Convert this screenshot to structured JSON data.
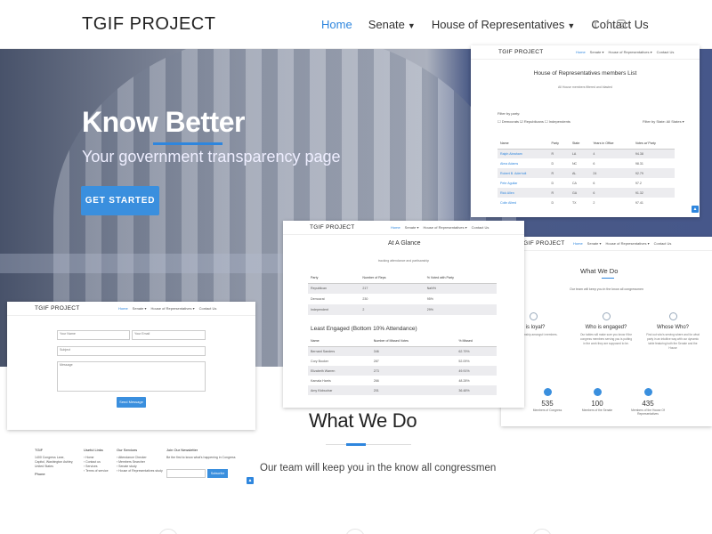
{
  "header": {
    "brand": "TGIF PROJECT",
    "nav": [
      {
        "label": "Home",
        "active": true,
        "dropdown": false
      },
      {
        "label": "Senate",
        "active": false,
        "dropdown": true
      },
      {
        "label": "House of Representatives",
        "active": false,
        "dropdown": true
      },
      {
        "label": "Contact Us",
        "active": false,
        "dropdown": false
      }
    ],
    "social_icons": [
      "twitter-icon",
      "facebook-icon",
      "instagram-icon"
    ]
  },
  "hero": {
    "title": "Know Better",
    "subtitle": "Your government transparency page",
    "cta": "GET STARTED"
  },
  "preview_house": {
    "brand": "TGIF PROJECT",
    "nav": [
      "Home",
      "Senate ▾",
      "House of Representatives ▾",
      "Contact Us"
    ],
    "title": "House of Representatives members List",
    "subtitle": "All House members filtered and blasted",
    "filter_label": "Filter by party:",
    "checkboxes": "☐ Democrats ☑ Republicans ☐ Independents",
    "state_filter": "Filter by State: All States ▾",
    "columns": [
      "Name",
      "Party",
      "State",
      "Years in Office",
      "Votes w/ Party"
    ],
    "rows": [
      [
        "Ralph Abraham",
        "R",
        "LA",
        "4",
        "94.38"
      ],
      [
        "Alma Adams",
        "D",
        "NC",
        "6",
        "98.31"
      ],
      [
        "Robert B. Aderholt",
        "R",
        "AL",
        "24",
        "92.79"
      ],
      [
        "Pete Aguilar",
        "D",
        "CA",
        "6",
        "97.2"
      ],
      [
        "Rick Allen",
        "R",
        "GA",
        "6",
        "91.32"
      ],
      [
        "Colin Allred",
        "D",
        "TX",
        "2",
        "97.41"
      ]
    ]
  },
  "preview_glance": {
    "brand": "TGIF PROJECT",
    "nav": [
      "Home",
      "Senate ▾",
      "House of Representatives ▾",
      "Contact Us"
    ],
    "title": "At A Glance",
    "subtitle": "tracking attendance and partisanship",
    "glance_columns": [
      "Party",
      "Number of Reps",
      "% Voted with Party"
    ],
    "glance_rows": [
      [
        "Republican",
        "217",
        "NaN%"
      ],
      [
        "Democrat",
        "230",
        "95%"
      ],
      [
        "Independent",
        "2",
        "29%"
      ]
    ],
    "section_title": "Least Engaged (Bottom 10% Attendance)",
    "least_columns": [
      "Name",
      "Number of Missed Votes",
      "% Missed"
    ],
    "least_rows": [
      [
        "Bernard Sanders",
        "346",
        "62.79%"
      ],
      [
        "Cory Booker",
        "287",
        "52.09%"
      ],
      [
        "Elizabeth Warren",
        "273",
        "49.91%"
      ],
      [
        "Kamala Harris",
        "266",
        "48.28%"
      ],
      [
        "Amy Klobuchar",
        "201",
        "36.48%"
      ]
    ]
  },
  "preview_whatwedo": {
    "brand": "TGIF PROJECT",
    "nav": [
      "Home",
      "Senate ▾",
      "House of Representatives ▾",
      "Contact Us"
    ],
    "title": "What We Do",
    "subtitle": "Our team will keep you in the know all congressmen",
    "features": [
      {
        "title": "o is loyal?",
        "desc": "...t of partisanship amongst t members."
      },
      {
        "title": "Who is engaged?",
        "desc": "Our tables will make sure you know if the congress members serving you is putting in the work they are supposed to be."
      },
      {
        "title": "Whose Who?",
        "desc": "Find out who's serving where and for what party in an intuitive way with our dynamic table featuring both the Senate and the House"
      }
    ],
    "stats": [
      {
        "value": "535",
        "label": "Members of Congress"
      },
      {
        "value": "100",
        "label": "Members of the Senate"
      },
      {
        "value": "435",
        "label": "Members of the House Of Representatives"
      }
    ]
  },
  "preview_contact": {
    "brand": "TGIF PROJECT",
    "nav": [
      "Home",
      "Senate ▾",
      "House of Representatives ▾",
      "Contact Us"
    ],
    "name_placeholder": "Your Name",
    "email_placeholder": "Your Email",
    "subject_placeholder": "Subject",
    "message_placeholder": "Message",
    "send": "Send Message"
  },
  "preview_footer": {
    "brand": "TGIF",
    "address": [
      "1400 Congress Lane,",
      "Capitol, Washington Ashley,",
      "United States"
    ],
    "phone_label": "Phone",
    "useful_title": "Useful Links",
    "useful_links": [
      "Home",
      "Contact us",
      "Services",
      "Terms of service"
    ],
    "services_title": "Our Services",
    "services": [
      "Attendance Checker",
      "Members Searcher",
      "Senate study",
      "House of Representatives study"
    ],
    "newsletter_title": "Join Our Newsletter",
    "newsletter_text": "Be the first to know what's happening in Congress",
    "subscribe": "Subscribe"
  },
  "main": {
    "title": "What We Do",
    "subtitle": "Our team will keep you in the know all congressmen"
  },
  "colors": {
    "accent": "#2e86de",
    "hero_overlay": "#46578a"
  }
}
